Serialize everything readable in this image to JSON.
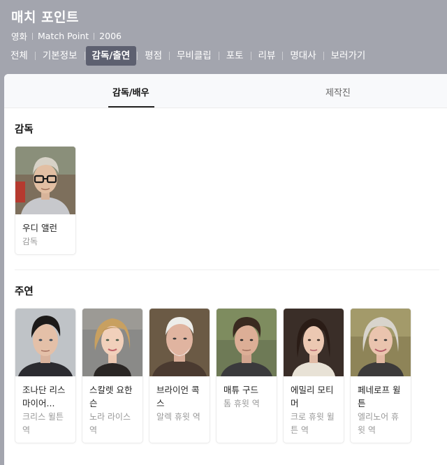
{
  "header": {
    "title": "매치 포인트",
    "meta": [
      "영화",
      "Match Point",
      "2006"
    ]
  },
  "nav": {
    "items": [
      "전체",
      "기본정보",
      "감독/출연",
      "평점",
      "무비클립",
      "포토",
      "리뷰",
      "명대사",
      "보러가기"
    ],
    "active_index": 2
  },
  "subtabs": {
    "items": [
      "감독/배우",
      "제작진"
    ],
    "active_index": 0
  },
  "director_section": {
    "title": "감독",
    "people": [
      {
        "name": "우디 앨런",
        "role": "감독"
      }
    ]
  },
  "cast_section": {
    "title": "주연",
    "people": [
      {
        "name": "조나단 리스 마이어...",
        "role": "크리스 윌튼 역"
      },
      {
        "name": "스칼렛 요한슨",
        "role": "노라 라이스 역"
      },
      {
        "name": "브라이언 콕스",
        "role": "알렉 휴윗 역"
      },
      {
        "name": "매튜 구드",
        "role": "톰 휴윗 역"
      },
      {
        "name": "에밀리 모티머",
        "role": "크로 휴윗 윌튼 역"
      },
      {
        "name": "페네로프 윌튼",
        "role": "엘리노어 휴윗 역"
      }
    ]
  }
}
